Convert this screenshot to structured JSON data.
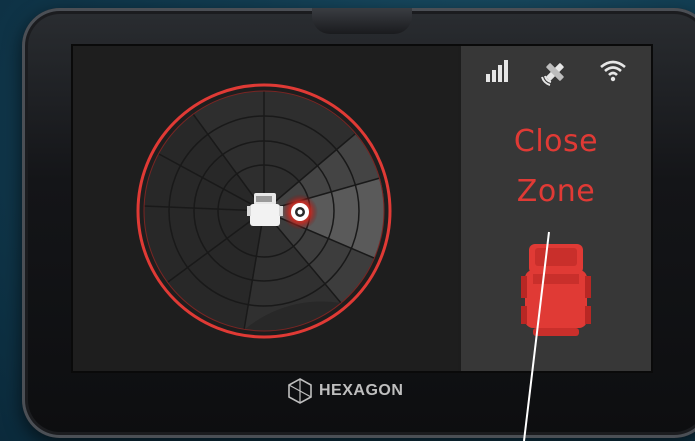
{
  "screen": {
    "status": {
      "signal_icon": "signal-strength-icon",
      "gps_icon": "satellite-icon",
      "wifi_icon": "wifi-icon"
    },
    "alert": {
      "line1": "Close",
      "line2": "Zone",
      "color": "#e03a35",
      "vehicle_icon": "vehicle-top-view-icon"
    },
    "radar": {
      "ring_color": "#e03a35",
      "highlight_color": "#d12d2b",
      "center_vehicle_icon": "truck-icon",
      "target_icon": "target-marker-icon"
    }
  },
  "device": {
    "brand_name": "HEXAGON",
    "brand_icon": "hexagon-logo-icon"
  }
}
